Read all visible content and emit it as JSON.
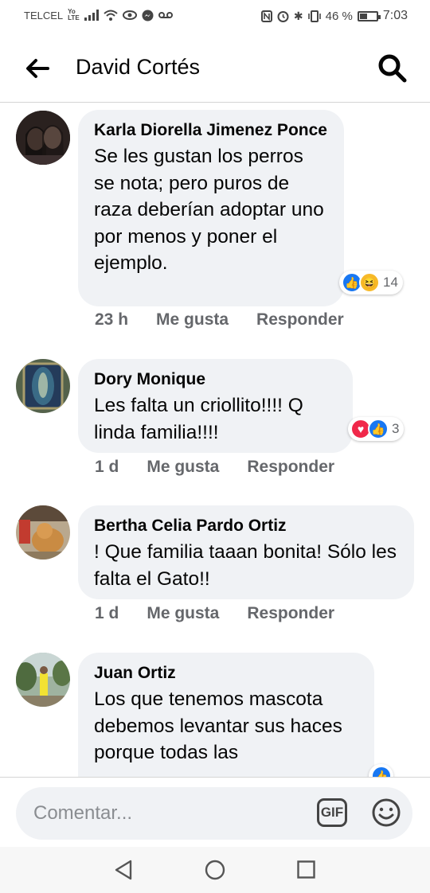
{
  "status_bar": {
    "carrier": "TELCEL",
    "network_top": "Yo",
    "network_bottom": "LTE",
    "battery": "46 %",
    "battery_level_percent": 46,
    "time": "7:03"
  },
  "header": {
    "title": "David Cortés",
    "back_icon": "arrow-left-icon",
    "search_icon": "search-icon"
  },
  "comments": [
    {
      "author": "Karla Diorella Jimenez Ponce",
      "text": "Se les gustan los perros se nota; pero puros de raza deberían adoptar uno por menos y poner el ejemplo.",
      "reactions": [
        "like",
        "haha"
      ],
      "reaction_count": "14",
      "time": "23 h",
      "like_label": "Me gusta",
      "reply_label": "Responder"
    },
    {
      "author": "Dory Monique",
      "text": "Les falta un criollito!!!! Q linda familia!!!!",
      "reactions": [
        "love",
        "like"
      ],
      "reaction_count": "3",
      "time": "1 d",
      "like_label": "Me gusta",
      "reply_label": "Responder"
    },
    {
      "author": "Bertha Celia Pardo Ortiz",
      "text": "! Que familia taaan bonita! Sólo les falta el Gato!!",
      "time": "1 d",
      "like_label": "Me gusta",
      "reply_label": "Responder"
    },
    {
      "author": "Juan Ortiz",
      "text": "Los que tenemos mascota debemos levantar sus haces porque todas las",
      "reactions": [
        "like"
      ]
    }
  ],
  "comment_input": {
    "placeholder": "Comentar...",
    "gif_label": "GIF",
    "emoji_icon": "smiley-icon"
  },
  "colors": {
    "bubble": "#f0f2f5",
    "meta_text": "#65676b",
    "like_blue": "#1877f2",
    "love_red": "#f0284a",
    "haha_yellow": "#f7b928"
  }
}
